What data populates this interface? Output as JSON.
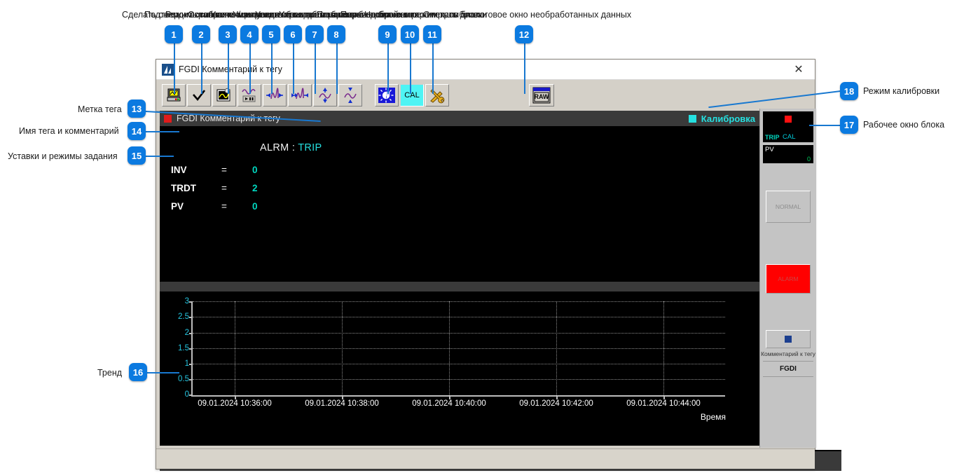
{
  "annotations": {
    "top": [
      {
        "n": "1",
        "label": "Сделать снимок экрана"
      },
      {
        "n": "2",
        "label": "Подтвердить сигнализацию"
      },
      {
        "n": "3",
        "label": "Режим отображения тренда"
      },
      {
        "n": "4",
        "label": "Остановить / запустить тренд"
      },
      {
        "n": "5",
        "label": "Увеличить масштаб по времени"
      },
      {
        "n": "6",
        "label": "Уменьшить масштаб по времени"
      },
      {
        "n": "7",
        "label": "Увеличить масштаб по значению"
      },
      {
        "n": "8",
        "label": "Уменьшить масштаб по значению"
      },
      {
        "n": "9",
        "label": "Параметры отображения"
      },
      {
        "n": "10",
        "label": "Перевод блока в режим калибровки"
      },
      {
        "n": "11",
        "label": "Настройка параметров блока"
      },
      {
        "n": "12",
        "label": "Открыть диалоговое окно необработанных данных"
      }
    ],
    "left": [
      {
        "n": "13",
        "label": "Метка тега"
      },
      {
        "n": "14",
        "label": "Имя тега и комментарий"
      },
      {
        "n": "15",
        "label": "Уставки и режимы задания"
      },
      {
        "n": "16",
        "label": "Тренд"
      }
    ],
    "right": [
      {
        "n": "17",
        "label": "Рабочее окно блока"
      },
      {
        "n": "18",
        "label": "Режим калибровки"
      }
    ]
  },
  "window": {
    "title": "FGDI Комментарий к тегу",
    "close_label": "✕"
  },
  "toolbar": {
    "buttons": [
      {
        "name": "screenshot-button",
        "icon": "printer-icon"
      },
      {
        "name": "acknowledge-button",
        "icon": "checkmark-icon"
      },
      {
        "name": "trend-mode-button",
        "icon": "chart-image-icon"
      },
      {
        "name": "trend-pause-button",
        "icon": "wave-play-pause-icon"
      },
      {
        "name": "time-zoom-in-button",
        "icon": "wave-arrows-in-icon"
      },
      {
        "name": "time-zoom-out-button",
        "icon": "wave-arrows-out-icon"
      },
      {
        "name": "value-zoom-in-button",
        "icon": "wave-arrows-vertical-in-icon"
      },
      {
        "name": "value-zoom-out-button",
        "icon": "wave-arrows-vertical-out-icon"
      },
      {
        "name": "display-settings-button",
        "icon": "brightness-icon"
      },
      {
        "name": "calibration-button",
        "icon": "cal-icon",
        "text": "CAL"
      },
      {
        "name": "block-config-button",
        "icon": "tools-icon"
      },
      {
        "name": "raw-data-button",
        "icon": "raw-icon",
        "text": "RAW"
      }
    ]
  },
  "faceplate": {
    "tag_name": "FGDI Комментарий к тегу",
    "calibration_label": "Калибровка",
    "alarm_label": "ALRM :",
    "alarm_value": "TRIP",
    "parameters": [
      {
        "name": "INV",
        "eq": "=",
        "value": "0"
      },
      {
        "name": "TRDT",
        "eq": "=",
        "value": "2"
      },
      {
        "name": "PV",
        "eq": "=",
        "value": "0"
      }
    ],
    "legend": "PV"
  },
  "chart_data": {
    "type": "line",
    "title": "",
    "xlabel": "Время",
    "ylabel": "",
    "series": [
      {
        "name": "PV",
        "values": []
      }
    ],
    "y_ticks": [
      "3",
      "2.5",
      "2",
      "1.5",
      "1",
      "0.5",
      "0"
    ],
    "ylim": [
      0,
      3
    ],
    "x_ticks": [
      "09.01.2024 10:36:00",
      "09.01.2024 10:38:00",
      "09.01.2024 10:40:00",
      "09.01.2024 10:42:00",
      "09.01.2024 10:44:00"
    ],
    "grid": true,
    "legend_position": "bottom"
  },
  "block_panel": {
    "trip_label": "TRIP",
    "cal_label": "CAL",
    "pv_label": "PV",
    "pv_value": "0",
    "normal_label": "NORMAL",
    "alarm_label": "ALARM",
    "comment_label": "Комментарий к тегу",
    "block_label": "FGDI"
  },
  "colors": {
    "accent": "#0b7ae0",
    "cyan": "#25e0e0",
    "alarm_red": "#ff0000",
    "window_face": "#d4d0c8"
  }
}
